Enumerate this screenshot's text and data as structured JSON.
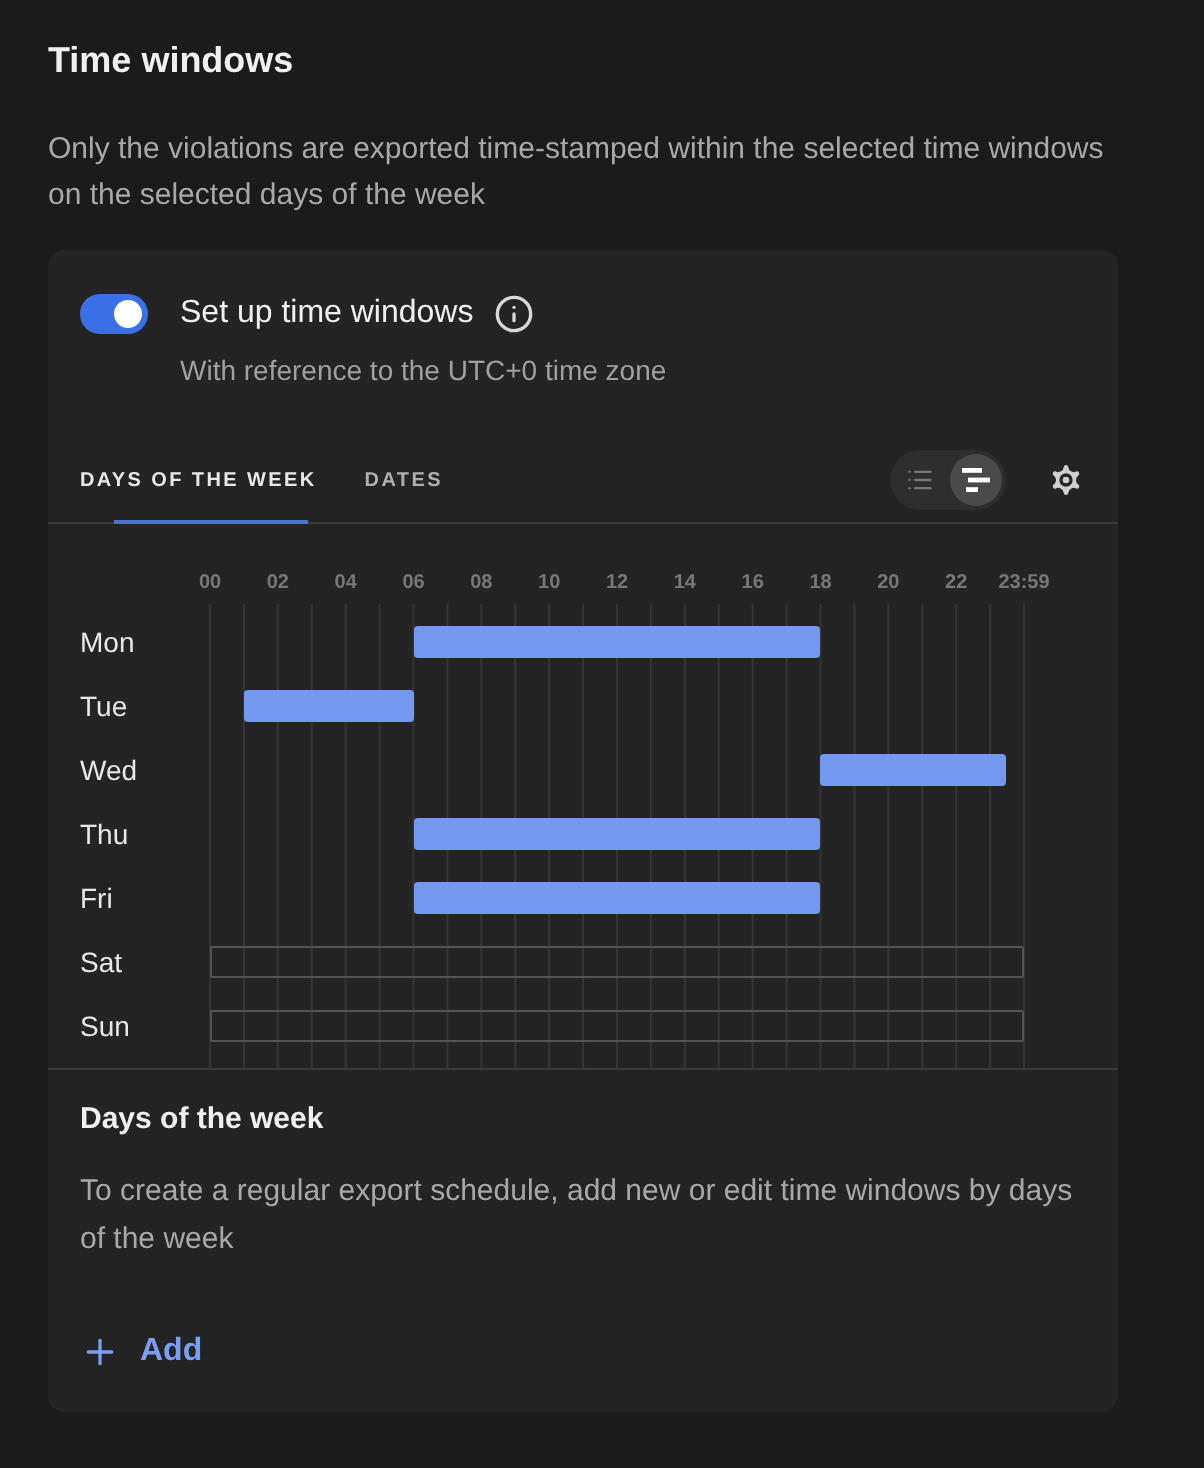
{
  "title": "Time windows",
  "description": "Only the violations are exported time-stamped within the selected time windows on the selected days of the week",
  "setup": {
    "label": "Set up time windows",
    "on": true,
    "hint": "With reference to the UTC+0 time zone"
  },
  "tabs": [
    {
      "label": "DAYS OF THE WEEK",
      "selected": true
    },
    {
      "label": "DATES",
      "selected": false
    }
  ],
  "view_modes": [
    {
      "kind": "list",
      "selected": false
    },
    {
      "kind": "timeline",
      "selected": true
    }
  ],
  "schedule": {
    "hour_labels": [
      "00",
      "02",
      "04",
      "06",
      "08",
      "10",
      "12",
      "14",
      "16",
      "18",
      "20",
      "22",
      "23:59"
    ],
    "days": [
      {
        "label": "Mon"
      },
      {
        "label": "Tue"
      },
      {
        "label": "Wed"
      },
      {
        "label": "Thu"
      },
      {
        "label": "Fri"
      },
      {
        "label": "Sat"
      },
      {
        "label": "Sun"
      }
    ]
  },
  "section": {
    "title": "Days of the week",
    "text": "To create a regular export schedule, add new or edit time windows by days of the week"
  },
  "add_button": {
    "label": "Add"
  }
}
